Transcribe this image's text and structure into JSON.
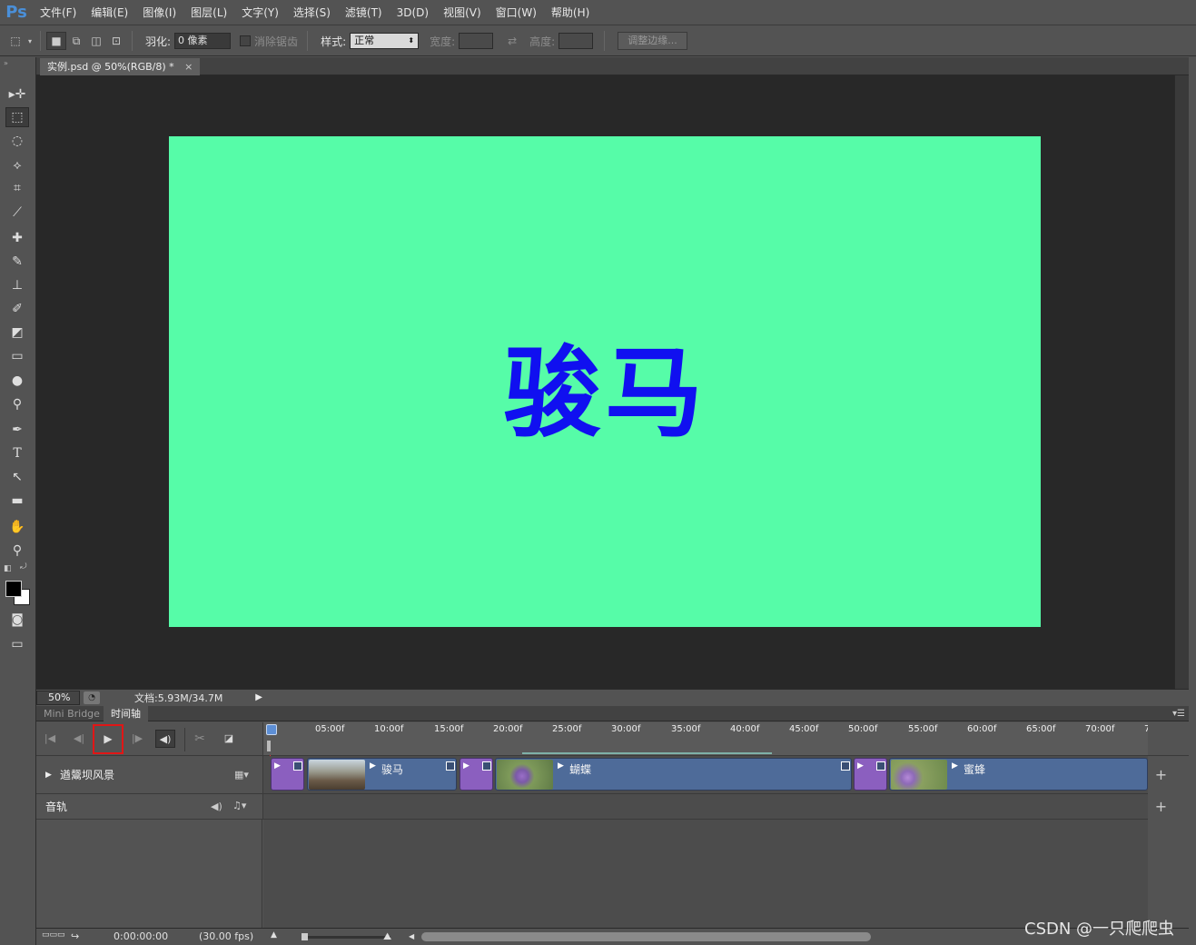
{
  "app": {
    "logo": "Ps"
  },
  "menu": [
    "文件(F)",
    "编辑(E)",
    "图像(I)",
    "图层(L)",
    "文字(Y)",
    "选择(S)",
    "滤镜(T)",
    "3D(D)",
    "视图(V)",
    "窗口(W)",
    "帮助(H)"
  ],
  "options": {
    "feather_label": "羽化:",
    "feather_value": "0 像素",
    "antialias_label": "消除锯齿",
    "style_label": "样式:",
    "style_value": "正常",
    "width_label": "宽度:",
    "height_label": "高度:",
    "refine_button": "调整边缘..."
  },
  "document": {
    "tab_title": "实例.psd @ 50%(RGB/8) *",
    "tab_close": "×",
    "canvas_text": "骏马",
    "canvas_bg": "#56fca8",
    "text_color": "#1010f0"
  },
  "status": {
    "zoom": "50%",
    "doc_size": "文档:5.93M/34.7M"
  },
  "panel": {
    "tabs": [
      "Mini Bridge",
      "时间轴"
    ],
    "menu_icon": "▾☰"
  },
  "timeline": {
    "ruler_ticks": [
      "05:00f",
      "10:00f",
      "15:00f",
      "20:00f",
      "25:00f",
      "30:00f",
      "35:00f",
      "40:00f",
      "45:00f",
      "50:00f",
      "55:00f",
      "60:00f",
      "65:00f",
      "70:00f",
      "7"
    ],
    "video_track_name": "遒鬶坝风景",
    "audio_track_name": "音轨",
    "clips": [
      {
        "name": "骏马"
      },
      {
        "name": "蝴蝶"
      },
      {
        "name": "蜜蜂"
      }
    ],
    "current_time": "0:00:00:00",
    "fps": "(30.00 fps)",
    "add_symbol": "+"
  },
  "watermark": "CSDN @一只爬爬虫"
}
